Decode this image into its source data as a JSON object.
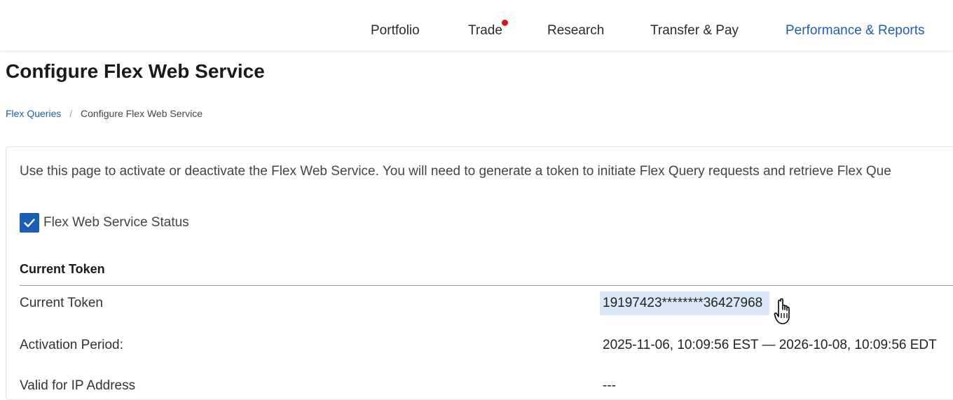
{
  "nav": {
    "items": [
      {
        "label": "Portfolio"
      },
      {
        "label": "Trade"
      },
      {
        "label": "Research"
      },
      {
        "label": "Transfer & Pay"
      },
      {
        "label": "Performance & Reports"
      }
    ],
    "active_color": "#1a5fb4",
    "notification_dot_color": "#d9131f"
  },
  "page": {
    "title": "Configure Flex Web Service"
  },
  "breadcrumb": {
    "parent": "Flex Queries",
    "separator": "/",
    "current": "Configure Flex Web Service"
  },
  "card": {
    "intro": "Use this page to activate or deactivate the Flex Web Service. You will need to generate a token to initiate Flex Query requests and retrieve Flex Que",
    "status_checkbox": {
      "label": "Flex Web Service Status",
      "checked": true
    },
    "section_heading": "Current Token",
    "rows": [
      {
        "label": "Current Token",
        "value": "19197423********36427968"
      },
      {
        "label": "Activation Period:",
        "value": "2025-11-06, 10:09:56 EST — 2026-10-08, 10:09:56 EDT"
      },
      {
        "label": "Valid for IP Address",
        "value": "---"
      }
    ]
  },
  "theme": {
    "accent": "#1a5fb4",
    "highlight": "#dbe8f7"
  },
  "icons": {
    "checkmark": "checkmark-icon",
    "cursor": "hand-cursor-icon"
  }
}
